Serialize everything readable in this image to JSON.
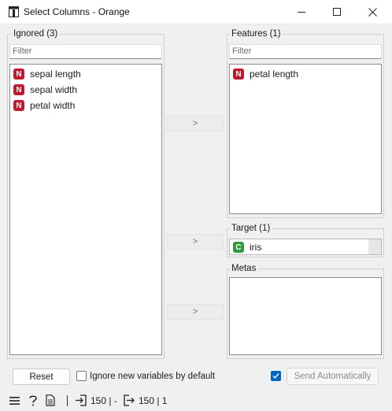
{
  "window": {
    "title": "Select Columns - Orange"
  },
  "ignored": {
    "title": "Ignored (3)",
    "filter_placeholder": "Filter",
    "items": [
      {
        "label": "sepal length",
        "type": "N"
      },
      {
        "label": "sepal width",
        "type": "N"
      },
      {
        "label": "petal width",
        "type": "N"
      }
    ]
  },
  "features": {
    "title": "Features (1)",
    "filter_placeholder": "Filter",
    "items": [
      {
        "label": "petal length",
        "type": "N"
      }
    ]
  },
  "target": {
    "title": "Target (1)",
    "items": [
      {
        "label": "iris",
        "type": "C"
      }
    ]
  },
  "metas": {
    "title": "Metas",
    "items": []
  },
  "move_buttons": {
    "features": ">",
    "target": ">",
    "metas": ">"
  },
  "bottom": {
    "reset_label": "Reset",
    "ignore_new_label": "Ignore new variables by default",
    "ignore_new_checked": false,
    "send_auto_label": "Send Automatically",
    "send_auto_checked": true
  },
  "status": {
    "input": "150 | -",
    "output": "150 | 1"
  },
  "colors": {
    "numeric_badge": "#c0182e",
    "categorical_badge": "#2e9b40",
    "checkbox_checked": "#0067c0"
  },
  "icons": {
    "app": "orange-app-icon",
    "minimize": "minimize-icon",
    "maximize": "maximize-icon",
    "close": "close-icon",
    "menu": "hamburger-menu-icon",
    "help": "help-icon",
    "report": "report-icon",
    "input": "input-arrow-icon",
    "output": "output-arrow-icon"
  }
}
